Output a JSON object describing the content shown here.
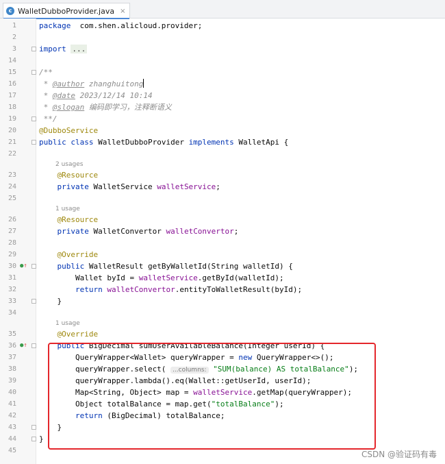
{
  "tab": {
    "label": "WalletDubboProvider.java",
    "close": "×",
    "icon_letter": "c"
  },
  "lines": [
    {
      "n": "1",
      "t": "package",
      "segments": [
        [
          "kw",
          "package"
        ],
        [
          "",
          "  com.shen.alicloud.provider;"
        ]
      ]
    },
    {
      "n": "2",
      "t": "blank"
    },
    {
      "n": "3",
      "t": "import",
      "segments": [
        [
          "kw",
          "import"
        ],
        [
          "",
          " "
        ],
        [
          "fold",
          "..."
        ]
      ]
    },
    {
      "n": "14",
      "t": "blank"
    },
    {
      "n": "15",
      "t": "cmt",
      "segments": [
        [
          "cmt",
          "/**"
        ]
      ]
    },
    {
      "n": "16",
      "t": "cmt",
      "segments": [
        [
          "cmt",
          " * "
        ],
        [
          "tag",
          "@author"
        ],
        [
          "cmt",
          " zhanghuitong"
        ],
        [
          "caret",
          ""
        ]
      ]
    },
    {
      "n": "17",
      "t": "cmt",
      "segments": [
        [
          "cmt",
          " * "
        ],
        [
          "tag",
          "@date"
        ],
        [
          "cmt",
          " 2023/12/14 10:14"
        ]
      ]
    },
    {
      "n": "18",
      "t": "cmt",
      "segments": [
        [
          "cmt",
          " * "
        ],
        [
          "tag",
          "@slogan"
        ],
        [
          "cmt",
          " 编码即学习，注释断语义"
        ]
      ]
    },
    {
      "n": "19",
      "t": "cmt",
      "segments": [
        [
          "cmt",
          " **/"
        ]
      ]
    },
    {
      "n": "20",
      "t": "code",
      "segments": [
        [
          "ann",
          "@DubboService"
        ]
      ]
    },
    {
      "n": "21",
      "t": "code",
      "segments": [
        [
          "kw",
          "public class"
        ],
        [
          "",
          " WalletDubboProvider "
        ],
        [
          "kw",
          "implements"
        ],
        [
          "",
          " WalletApi {"
        ]
      ]
    },
    {
      "n": "22",
      "t": "blank"
    },
    {
      "n": "",
      "t": "inlay",
      "text": "2 usages"
    },
    {
      "n": "23",
      "t": "code",
      "segments": [
        [
          "",
          "    "
        ],
        [
          "ann",
          "@Resource"
        ]
      ]
    },
    {
      "n": "24",
      "t": "code",
      "segments": [
        [
          "",
          "    "
        ],
        [
          "kw",
          "private"
        ],
        [
          "",
          " WalletService "
        ],
        [
          "fld",
          "walletService"
        ],
        [
          "",
          ";"
        ]
      ]
    },
    {
      "n": "25",
      "t": "blank"
    },
    {
      "n": "",
      "t": "inlay",
      "text": "1 usage"
    },
    {
      "n": "26",
      "t": "code",
      "segments": [
        [
          "",
          "    "
        ],
        [
          "ann",
          "@Resource"
        ]
      ]
    },
    {
      "n": "27",
      "t": "code",
      "segments": [
        [
          "",
          "    "
        ],
        [
          "kw",
          "private"
        ],
        [
          "",
          " WalletConvertor "
        ],
        [
          "fld",
          "walletConvertor"
        ],
        [
          "",
          ";"
        ]
      ]
    },
    {
      "n": "28",
      "t": "blank"
    },
    {
      "n": "29",
      "t": "code",
      "segments": [
        [
          "",
          "    "
        ],
        [
          "ann",
          "@Override"
        ]
      ]
    },
    {
      "n": "30",
      "t": "code",
      "segments": [
        [
          "",
          "    "
        ],
        [
          "kw",
          "public"
        ],
        [
          "",
          " WalletResult getByWalletId(String walletId) {"
        ]
      ]
    },
    {
      "n": "31",
      "t": "code",
      "segments": [
        [
          "",
          "        Wallet byId = "
        ],
        [
          "fld",
          "walletService"
        ],
        [
          "",
          ".getById(walletId);"
        ]
      ]
    },
    {
      "n": "32",
      "t": "code",
      "segments": [
        [
          "",
          "        "
        ],
        [
          "kw",
          "return"
        ],
        [
          "",
          " "
        ],
        [
          "fld",
          "walletConvertor"
        ],
        [
          "",
          ".entityToWalletResult(byId);"
        ]
      ]
    },
    {
      "n": "33",
      "t": "code",
      "segments": [
        [
          "",
          "    }"
        ]
      ]
    },
    {
      "n": "34",
      "t": "blank"
    },
    {
      "n": "",
      "t": "inlay",
      "text": "1 usage"
    },
    {
      "n": "35",
      "t": "code",
      "segments": [
        [
          "",
          "    "
        ],
        [
          "ann",
          "@Override"
        ]
      ]
    },
    {
      "n": "36",
      "t": "code",
      "segments": [
        [
          "",
          "    "
        ],
        [
          "kw",
          "public"
        ],
        [
          "",
          " BigDecimal sumUserAvailableBalance(Integer userId) {"
        ]
      ]
    },
    {
      "n": "37",
      "t": "code",
      "segments": [
        [
          "",
          "        QueryWrapper<Wallet> queryWrapper = "
        ],
        [
          "kw",
          "new"
        ],
        [
          "",
          " QueryWrapper<>();"
        ]
      ]
    },
    {
      "n": "38",
      "t": "code",
      "segments": [
        [
          "",
          "        queryWrapper.select( "
        ],
        [
          "hint",
          "...columns:"
        ],
        [
          "",
          " "
        ],
        [
          "str",
          "\"SUM(balance) AS totalBalance\""
        ],
        [
          "",
          ");"
        ]
      ]
    },
    {
      "n": "39",
      "t": "code",
      "segments": [
        [
          "",
          "        queryWrapper.lambda().eq(Wallet::getUserId, userId);"
        ]
      ]
    },
    {
      "n": "40",
      "t": "code",
      "segments": [
        [
          "",
          "        Map<String, Object> map = "
        ],
        [
          "fld",
          "walletService"
        ],
        [
          "",
          ".getMap(queryWrapper);"
        ]
      ]
    },
    {
      "n": "41",
      "t": "code",
      "segments": [
        [
          "",
          "        Object totalBalance = map.get("
        ],
        [
          "str",
          "\"totalBalance\""
        ],
        [
          "",
          ");"
        ]
      ]
    },
    {
      "n": "42",
      "t": "code",
      "segments": [
        [
          "",
          "        "
        ],
        [
          "kw",
          "return"
        ],
        [
          "",
          " (BigDecimal) totalBalance;"
        ]
      ]
    },
    {
      "n": "43",
      "t": "code",
      "segments": [
        [
          "",
          "    }"
        ]
      ]
    },
    {
      "n": "44",
      "t": "code",
      "segments": [
        [
          "",
          "}"
        ]
      ]
    },
    {
      "n": "45",
      "t": "blank"
    }
  ],
  "watermark": "CSDN @验证码有毒",
  "colors": {
    "keyword": "#0033b3",
    "annotation": "#9e880d",
    "field": "#871094",
    "string": "#067d17",
    "highlight_box": "#e4262b"
  }
}
